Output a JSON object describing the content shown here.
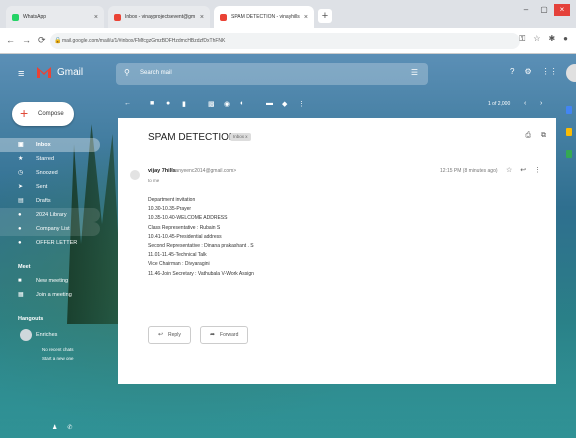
{
  "browser": {
    "tabs": [
      {
        "label": "WhatsApp",
        "icon": "whatsapp-icon"
      },
      {
        "label": "Inbox - vinayprojectsevent@gm",
        "icon": "gmail-icon"
      },
      {
        "label": "SPAM DETECTION - vinayhills",
        "icon": "gmail-icon"
      }
    ],
    "url": "mail.google.com/mail/u/1/#inbox/FMfcgzGmzBDFHzdmcHBzdzfDxThFNK"
  },
  "gmail": {
    "brand": "Gmail",
    "search_placeholder": "Search mail",
    "compose_label": "Compose",
    "sidebar": [
      {
        "label": "Inbox",
        "icon": "inbox-icon"
      },
      {
        "label": "Starred",
        "icon": "star-icon"
      },
      {
        "label": "Snoozed",
        "icon": "clock-icon"
      },
      {
        "label": "Sent",
        "icon": "send-icon"
      },
      {
        "label": "Drafts",
        "icon": "draft-icon"
      },
      {
        "label": "2024 Library",
        "icon": "label-icon"
      },
      {
        "label": "Company List",
        "icon": "label-icon"
      },
      {
        "label": "OFFER LETTER",
        "icon": "label-icon"
      }
    ],
    "meet": {
      "title": "Meet",
      "items": [
        {
          "label": "New meeting",
          "icon": "video-icon"
        },
        {
          "label": "Join a meeting",
          "icon": "keyboard-icon"
        }
      ]
    },
    "hangouts": {
      "title": "Hangouts",
      "user": "Enriches",
      "no_chats": "No recent chats",
      "start_new": "Start a new one"
    },
    "pagination": "1 of 2,000"
  },
  "message": {
    "subject": "SPAM DETECTION",
    "label": "Inbox x",
    "sender_name": "vijay 7hills",
    "sender_email": "<vanyeenc2014@gmail.com>",
    "to": "to me",
    "time": "12:15 PM (8 minutes ago)",
    "body": [
      "Department  invitation",
      "10.30-10.35-Prayer",
      "10.35-10.40-WELCOME ADDRESS",
      " Class Representative : Rubain S",
      "10.41-10.45-Presidential address",
      "Second Representative : Dinana prakashant . S",
      "11.01-11.45-Technical Talk",
      "Vice Chairman : Divyaragini",
      "11.46-Join Secretary : Vathubala V-Work Assign"
    ],
    "reply_label": "Reply",
    "forward_label": "Forward"
  }
}
